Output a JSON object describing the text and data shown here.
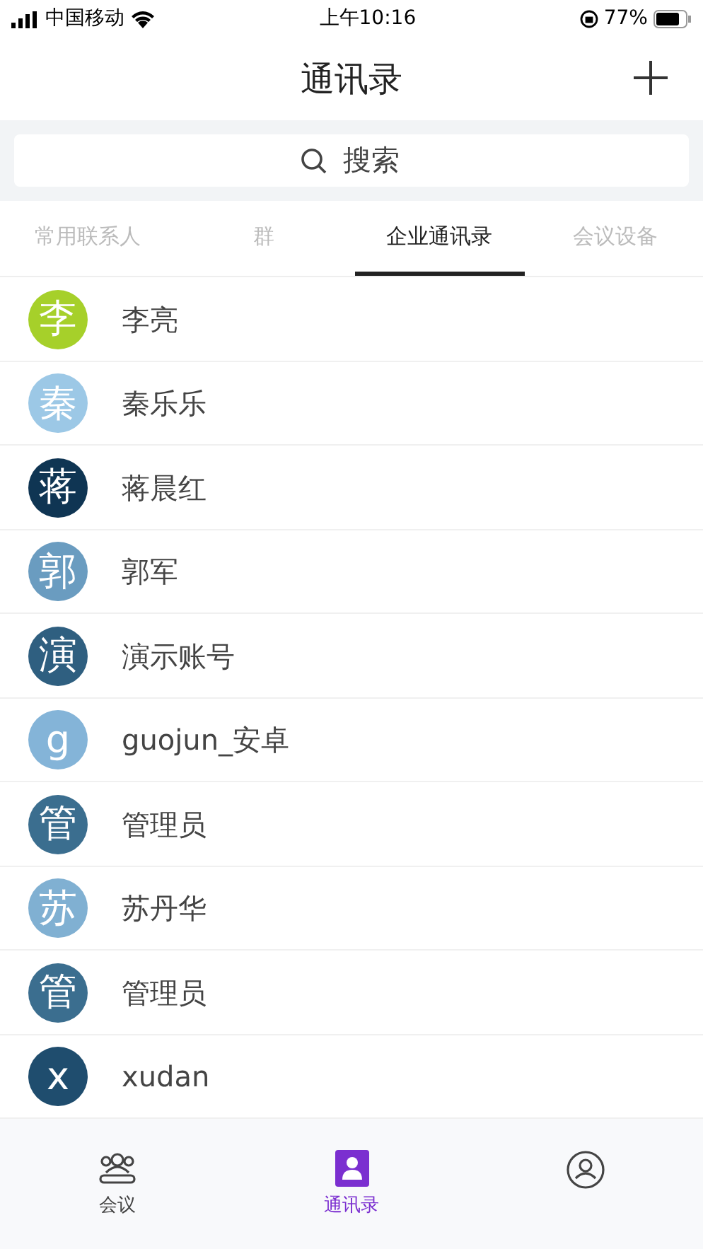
{
  "status_bar": {
    "carrier": "中国移动",
    "time": "上午10:16",
    "battery": "77%"
  },
  "header": {
    "title": "通讯录"
  },
  "search": {
    "placeholder": "搜索"
  },
  "tabs": [
    {
      "label": "常用联系人",
      "selected": false
    },
    {
      "label": "群",
      "selected": false
    },
    {
      "label": "企业通讯录",
      "selected": true
    },
    {
      "label": "会议设备",
      "selected": false
    }
  ],
  "contacts": [
    {
      "initial": "李",
      "name": "李亮",
      "color": "#a6d02a"
    },
    {
      "initial": "秦",
      "name": "秦乐乐",
      "color": "#9cc8e6"
    },
    {
      "initial": "蒋",
      "name": "蒋晨红",
      "color": "#0f3553"
    },
    {
      "initial": "郭",
      "name": "郭军",
      "color": "#6a9cc0"
    },
    {
      "initial": "演",
      "name": "演示账号",
      "color": "#2f5f80"
    },
    {
      "initial": "g",
      "name": "guojun_安卓",
      "color": "#84b4d8"
    },
    {
      "initial": "管",
      "name": "管理员",
      "color": "#3b6e8f"
    },
    {
      "initial": "苏",
      "name": "苏丹华",
      "color": "#80b0d2"
    },
    {
      "initial": "管",
      "name": "管理员",
      "color": "#3b6e8f"
    },
    {
      "initial": "x",
      "name": "xudan",
      "color": "#1f4d6e"
    }
  ],
  "bottom_nav": [
    {
      "kind": "meeting",
      "label": "会议",
      "selected": false
    },
    {
      "kind": "contacts",
      "label": "通讯录",
      "selected": true
    },
    {
      "kind": "profile",
      "selected": false
    }
  ]
}
